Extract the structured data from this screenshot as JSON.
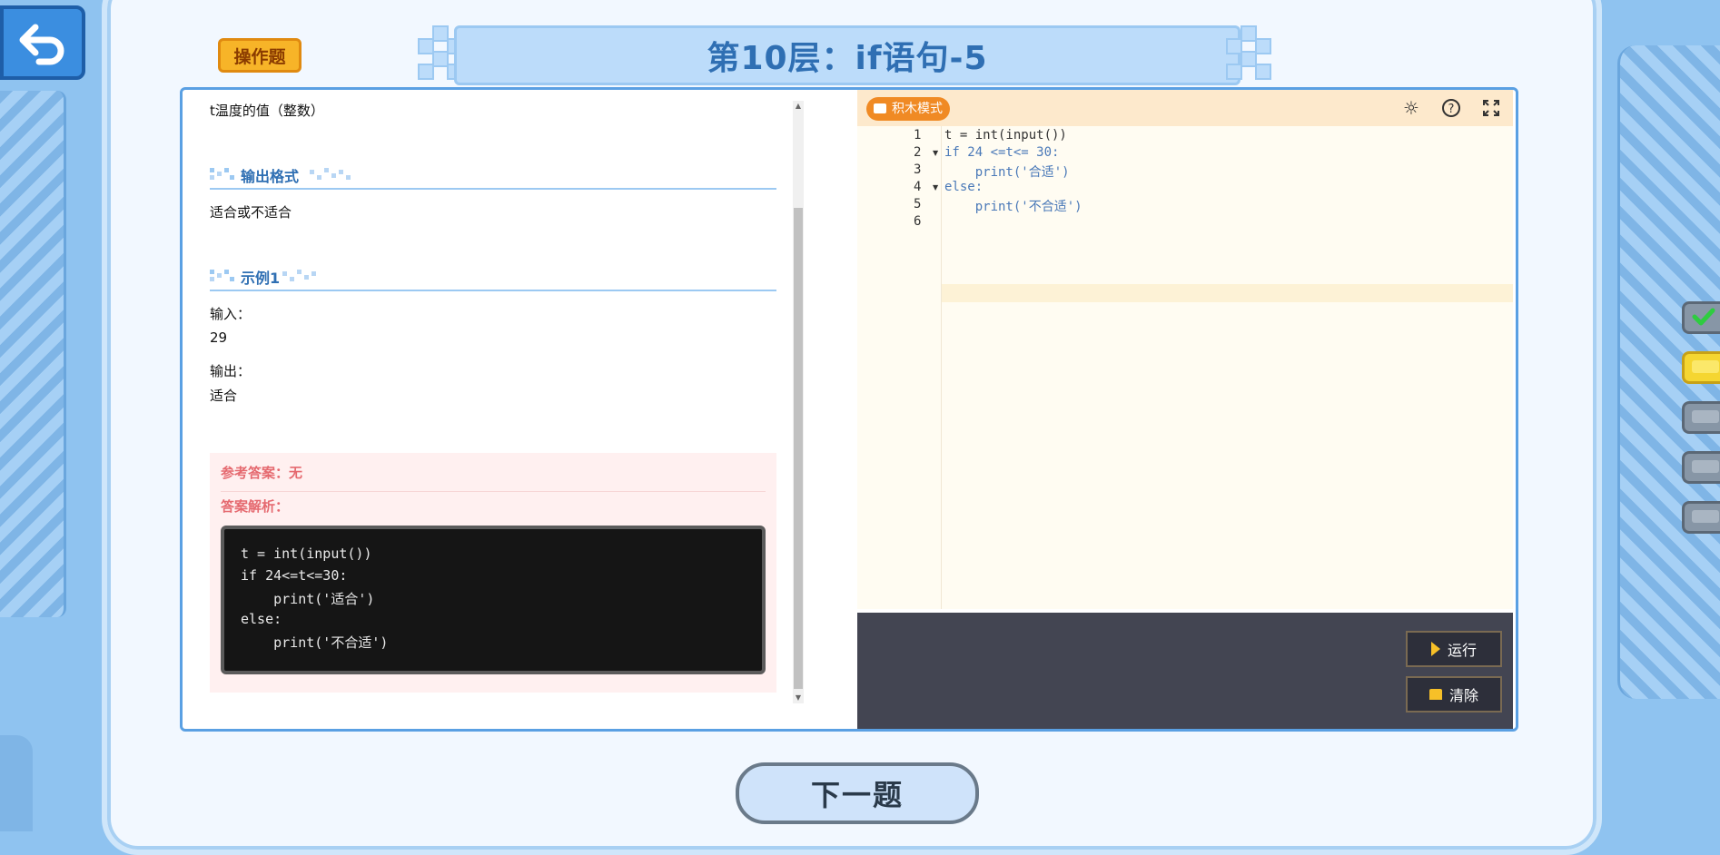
{
  "header": {
    "task_badge": "操作题",
    "title": "第10层：if语句-5"
  },
  "problem": {
    "intro_line": "t温度的值（整数）",
    "output_format": {
      "heading": "输出格式",
      "text": "适合或不适合"
    },
    "example": {
      "heading": "示例1",
      "input_label": "输入：",
      "input_value": "29",
      "output_label": "输出：",
      "output_value": "适合"
    },
    "answer": {
      "reference_label": "参考答案：无",
      "analysis_label": "答案解析：",
      "code_lines": [
        "t = int(input())",
        "if 24<=t<=30:",
        "    print('适合')",
        "else:",
        "    print('不合适')"
      ]
    }
  },
  "editor": {
    "block_mode_label": "积木模式",
    "toolbar_icons": [
      "brightness-icon",
      "help-icon",
      "fullscreen-icon"
    ],
    "line_numbers": [
      "1",
      "2",
      "3",
      "4",
      "5",
      "6"
    ],
    "code_lines": [
      "t = int(input())",
      "if 24 <=t<= 30:",
      "    print('合适')",
      "else:",
      "    print('不合适')",
      ""
    ],
    "active_line": 5
  },
  "console": {
    "run_label": "运行",
    "clear_label": "清除"
  },
  "footer": {
    "next_label": "下一题"
  },
  "side_levels": [
    {
      "state": "done"
    },
    {
      "state": "current"
    },
    {
      "state": "locked"
    },
    {
      "state": "locked"
    },
    {
      "state": "locked"
    }
  ],
  "colors": {
    "accent_blue": "#2f6fb3",
    "badge_orange": "#f7b428",
    "answer_red": "#e5696f",
    "toolbar_peach": "#fde9cc",
    "console_bg": "#434552"
  }
}
